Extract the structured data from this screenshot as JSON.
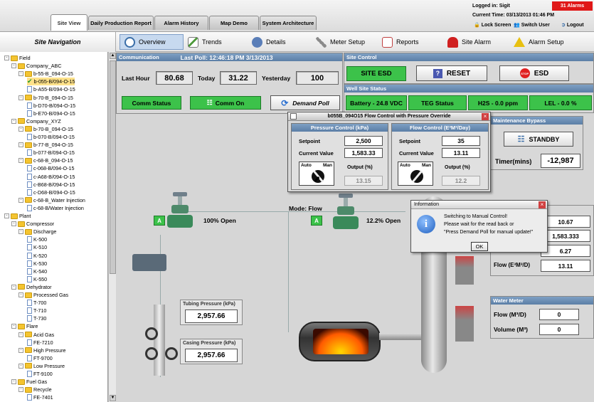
{
  "header": {
    "tabs": [
      "Site View",
      "Daily Production Report",
      "Alarm History",
      "Map Demo",
      "System Architecture"
    ],
    "logged_in": "Logged in: Sigit",
    "current_time": "Current Time: 03/13/2013 01:46 PM",
    "alarms_badge": "31 Alarms",
    "lock_screen": "Lock Screen",
    "switch_user": "Switch User",
    "logout": "Logout"
  },
  "nav": {
    "title": "Site Navigation",
    "tree": [
      {
        "label": "Field",
        "depth": 0,
        "kind": "folder"
      },
      {
        "label": "Company_ABC",
        "depth": 1,
        "kind": "folder"
      },
      {
        "label": "b-55-B_094-O-15",
        "depth": 2,
        "kind": "folder"
      },
      {
        "label": "b-055-B/094-O-15",
        "depth": 3,
        "kind": "check",
        "selected": true
      },
      {
        "label": "b-A55-B/094-O-15",
        "depth": 3,
        "kind": "doc"
      },
      {
        "label": "b-70-B_094-O-15",
        "depth": 2,
        "kind": "folder"
      },
      {
        "label": "b-D70-B/094-O-15",
        "depth": 3,
        "kind": "doc"
      },
      {
        "label": "b-E70-B/094-O-15",
        "depth": 3,
        "kind": "doc"
      },
      {
        "label": "Company_XYZ",
        "depth": 1,
        "kind": "folder"
      },
      {
        "label": "b-70-B_094-O-15",
        "depth": 2,
        "kind": "folder"
      },
      {
        "label": "b-070-B/094-O-15",
        "depth": 3,
        "kind": "doc"
      },
      {
        "label": "b-77-B_094-O-15",
        "depth": 2,
        "kind": "folder"
      },
      {
        "label": "b-077-B/094-O-15",
        "depth": 3,
        "kind": "doc"
      },
      {
        "label": "c-68-B_094-O-15",
        "depth": 2,
        "kind": "folder"
      },
      {
        "label": "c-068-B/094-O-15",
        "depth": 3,
        "kind": "doc"
      },
      {
        "label": "c-A68-B/094-O-15",
        "depth": 3,
        "kind": "doc"
      },
      {
        "label": "c-B68-B/094-O-15",
        "depth": 3,
        "kind": "doc"
      },
      {
        "label": "c-D68-B/094-O-15",
        "depth": 3,
        "kind": "doc"
      },
      {
        "label": "c-68-B_Water Injection",
        "depth": 2,
        "kind": "folder"
      },
      {
        "label": "c-68-B/Water Injection",
        "depth": 3,
        "kind": "doc"
      },
      {
        "label": "Plant",
        "depth": 0,
        "kind": "folder"
      },
      {
        "label": "Compressor",
        "depth": 1,
        "kind": "folder"
      },
      {
        "label": "Discharge",
        "depth": 2,
        "kind": "folder"
      },
      {
        "label": "K-500",
        "depth": 3,
        "kind": "doc"
      },
      {
        "label": "K-510",
        "depth": 3,
        "kind": "doc"
      },
      {
        "label": "K-520",
        "depth": 3,
        "kind": "doc"
      },
      {
        "label": "K-530",
        "depth": 3,
        "kind": "doc"
      },
      {
        "label": "K-540",
        "depth": 3,
        "kind": "doc"
      },
      {
        "label": "K-550",
        "depth": 3,
        "kind": "doc"
      },
      {
        "label": "Dehydrator",
        "depth": 1,
        "kind": "folder"
      },
      {
        "label": "Processed Gas",
        "depth": 2,
        "kind": "folder"
      },
      {
        "label": "T-700",
        "depth": 3,
        "kind": "doc"
      },
      {
        "label": "T-710",
        "depth": 3,
        "kind": "doc"
      },
      {
        "label": "T-730",
        "depth": 3,
        "kind": "doc"
      },
      {
        "label": "Flare",
        "depth": 1,
        "kind": "folder"
      },
      {
        "label": "Acid Gas",
        "depth": 2,
        "kind": "folder"
      },
      {
        "label": "FE-7210",
        "depth": 3,
        "kind": "doc"
      },
      {
        "label": "High Pressure",
        "depth": 2,
        "kind": "folder"
      },
      {
        "label": "FT-9700",
        "depth": 3,
        "kind": "doc"
      },
      {
        "label": "Low Pressure",
        "depth": 2,
        "kind": "folder"
      },
      {
        "label": "FT-9100",
        "depth": 3,
        "kind": "doc"
      },
      {
        "label": "Fuel Gas",
        "depth": 1,
        "kind": "folder"
      },
      {
        "label": "Recycle",
        "depth": 2,
        "kind": "folder"
      },
      {
        "label": "FE-7401",
        "depth": 3,
        "kind": "doc"
      }
    ]
  },
  "toolbar": {
    "items": [
      {
        "label": "Overview",
        "icon": "gauge-icon",
        "color": "#3a6ea8"
      },
      {
        "label": "Trends",
        "icon": "chart-icon",
        "color": "#4d9a3a"
      },
      {
        "label": "Details",
        "icon": "gear-icon",
        "color": "#5a7eb8"
      },
      {
        "label": "Meter Setup",
        "icon": "wrench-icon",
        "color": "#8a8a8a"
      },
      {
        "label": "Reports",
        "icon": "report-icon",
        "color": "#c04040"
      },
      {
        "label": "Site Alarm",
        "icon": "siren-icon",
        "color": "#d02020"
      },
      {
        "label": "Alarm Setup",
        "icon": "warning-icon",
        "color": "#e8c010"
      }
    ]
  },
  "communication": {
    "title": "Communication",
    "last_poll": "Last Poll:   12:46:18 PM 3/13/2013",
    "last_hour_label": "Last Hour",
    "last_hour_value": "80.68",
    "today_label": "Today",
    "today_value": "31.22",
    "yesterday_label": "Yesterday",
    "yesterday_value": "100",
    "comm_status": "Comm Status",
    "comm_on": "Comm On",
    "demand_poll": "Demand Poll"
  },
  "site_control": {
    "title": "Site Control",
    "site_esd": "SITE ESD",
    "reset": "RESET",
    "esd": "ESD",
    "stop_label": "STOP"
  },
  "well_status": {
    "title": "Well Site Status",
    "battery": "Battery - 24.8 VDC",
    "teg": "TEG Status",
    "h2s": "H2S - 0.0 ppm",
    "lel": "LEL - 0.0 %"
  },
  "maintenance": {
    "title": "Maintenance Bypass",
    "standby": "STANDBY",
    "timer_label": "Timer(mins)",
    "timer_value": "-12,987"
  },
  "flow_control_dialog": {
    "title": "b055B_094O15 Flow Control with Pressure Override",
    "pressure": {
      "title": "Pressure Control (kPa)",
      "setpoint_label": "Setpoint",
      "setpoint": "2,500",
      "current_label": "Current Value",
      "current": "1,583.33",
      "auto": "Auto",
      "man": "Man",
      "output_label": "Output (%)",
      "output": "13.15"
    },
    "flow": {
      "title": "Flow Control (E³M³/Day)",
      "setpoint_label": "Setpoint",
      "setpoint": "35",
      "current_label": "Current Value",
      "current": "13.11",
      "auto": "Auto",
      "man": "Man",
      "output_label": "Output (%)",
      "output": "12.2"
    }
  },
  "info_dialog": {
    "title": "Information",
    "line1": "Switching to Manual Control!",
    "line2": "Please wait for the read back or",
    "line3": "\"Press Demand Poll for manual update!\"",
    "ok": "OK",
    "icon_letter": "i"
  },
  "process": {
    "valve1_open": "100% Open",
    "valve2_open": "12.2% Open",
    "mode": "Mode: Flow",
    "valve_tag": "A",
    "tubing_label": "Tubing Pressure (kPa)",
    "tubing_value": "2,957.66",
    "casing_label": "Casing Pressure (kPa)",
    "casing_value": "2,957.66"
  },
  "meter_panel": {
    "v1": "10.67",
    "v2": "1,583.333",
    "v3": "6.27",
    "flow_label": "Flow (E³M³/D)",
    "flow_value": "13.11"
  },
  "water_meter": {
    "title": "Water Meter",
    "flow_label": "Flow (M³/D)",
    "flow_value": "0",
    "volume_label": "Volume (M³)",
    "volume_value": "0"
  },
  "colors": {
    "ok_green": "#3cc24a",
    "alarm_red": "#e01818",
    "panel_blue": "#5b7ea6"
  }
}
